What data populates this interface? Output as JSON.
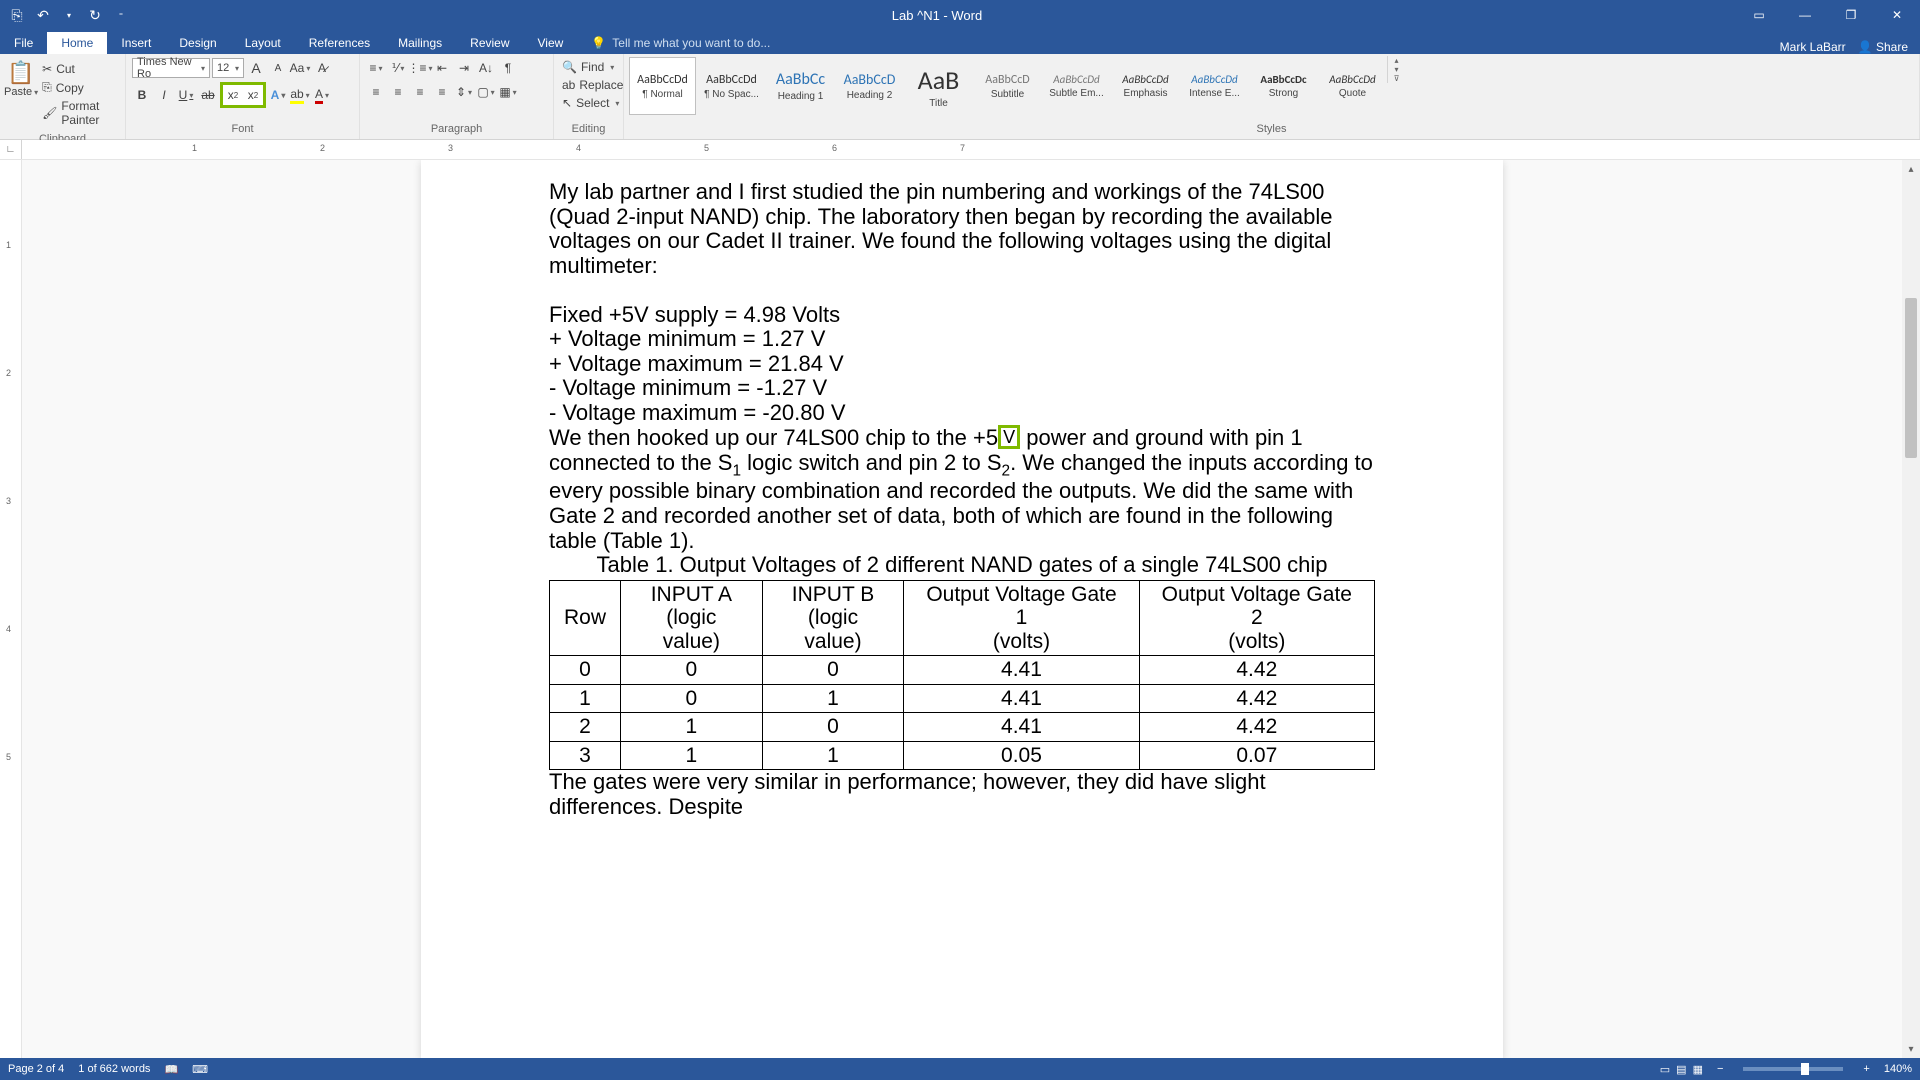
{
  "title": "Lab ^N1 - Word",
  "user": "Mark LaBarr",
  "share": "Share",
  "tabs": [
    "File",
    "Home",
    "Insert",
    "Design",
    "Layout",
    "References",
    "Mailings",
    "Review",
    "View"
  ],
  "active_tab": "Home",
  "tell_me": "Tell me what you want to do...",
  "clipboard": {
    "paste": "Paste",
    "cut": "Cut",
    "copy": "Copy",
    "painter": "Format Painter",
    "label": "Clipboard"
  },
  "font": {
    "name": "Times New Ro",
    "size": "12",
    "label": "Font"
  },
  "paragraph": {
    "label": "Paragraph"
  },
  "editing": {
    "find": "Find",
    "replace": "Replace",
    "select": "Select",
    "label": "Editing"
  },
  "styles": {
    "label": "Styles",
    "items": [
      {
        "preview": "AaBbCcDd",
        "name": "¶ Normal",
        "size": "12px",
        "selected": true
      },
      {
        "preview": "AaBbCcDd",
        "name": "¶ No Spac...",
        "size": "12px"
      },
      {
        "preview": "AaBbCc",
        "name": "Heading 1",
        "size": "16px",
        "color": "#2e74b5"
      },
      {
        "preview": "AaBbCcD",
        "name": "Heading 2",
        "size": "14px",
        "color": "#2e74b5"
      },
      {
        "preview": "AaB",
        "name": "Title",
        "size": "26px"
      },
      {
        "preview": "AaBbCcD",
        "name": "Subtitle",
        "size": "12px",
        "color": "#777"
      },
      {
        "preview": "AaBbCcDd",
        "name": "Subtle Em...",
        "size": "11px",
        "style": "italic",
        "color": "#777"
      },
      {
        "preview": "AaBbCcDd",
        "name": "Emphasis",
        "size": "11px",
        "style": "italic"
      },
      {
        "preview": "AaBbCcDd",
        "name": "Intense E...",
        "size": "11px",
        "style": "italic",
        "color": "#2e74b5"
      },
      {
        "preview": "AaBbCcDc",
        "name": "Strong",
        "size": "11px",
        "weight": "bold"
      },
      {
        "preview": "AaBbCcDd",
        "name": "Quote",
        "size": "11px",
        "style": "italic"
      }
    ]
  },
  "ruler_h": [
    "1",
    "2",
    "3",
    "4",
    "5",
    "6",
    "7"
  ],
  "ruler_v": [
    "1",
    "2",
    "3",
    "4",
    "5"
  ],
  "doc": {
    "para1": "My lab partner and I first studied the pin numbering and workings of the 74LS00 (Quad 2-input NAND) chip. The laboratory then began by recording the available voltages on our Cadet II trainer. We found the following voltages using the digital multimeter:",
    "voltages": [
      "Fixed +5V supply = 4.98 Volts",
      "+ Voltage minimum = 1.27 V",
      "+ Voltage maximum = 21.84 V",
      "- Voltage minimum = -1.27 V",
      "- Voltage maximum = -20.80 V"
    ],
    "para2_a": "We then hooked up our 74LS00 chip to the +5",
    "para2_hl": "V",
    "para2_b": " power and ground with pin 1 connected to the S",
    "para2_c": " logic switch and pin 2 to S",
    "para2_d": ". We changed the inputs according to every possible binary combination and recorded the outputs. We did the same with Gate 2 and recorded another set of data, both of which are found in the following table (Table 1).",
    "table_caption": "Table 1. Output Voltages of 2 different NAND gates of a single 74LS00 chip",
    "table_headers": [
      "Row",
      "INPUT A\n(logic value)",
      "INPUT B\n(logic value)",
      "Output Voltage Gate 1\n(volts)",
      "Output Voltage Gate 2\n(volts)"
    ],
    "table_rows": [
      [
        "0",
        "0",
        "0",
        "4.41",
        "4.42"
      ],
      [
        "1",
        "0",
        "1",
        "4.41",
        "4.42"
      ],
      [
        "2",
        "1",
        "0",
        "4.41",
        "4.42"
      ],
      [
        "3",
        "1",
        "1",
        "0.05",
        "0.07"
      ]
    ],
    "para3": "The gates were very similar in performance; however, they did have slight differences. Despite"
  },
  "status": {
    "page": "Page 2 of 4",
    "words": "1 of 662 words",
    "zoom": "140%"
  }
}
